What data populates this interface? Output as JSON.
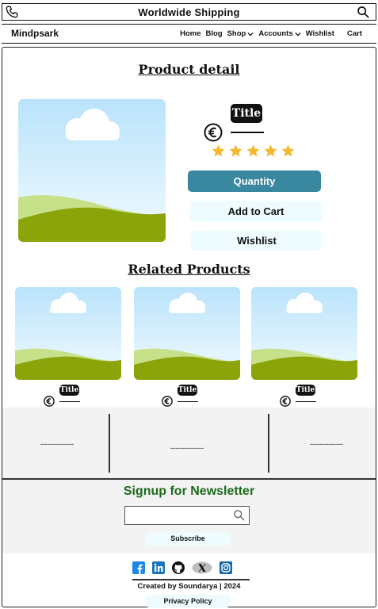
{
  "topbar": {
    "shipping_text": "Worldwide Shipping",
    "phone_icon": "phone-icon",
    "search_icon": "search-icon"
  },
  "nav": {
    "brand": "Mindpsark",
    "items": [
      {
        "label": "Home"
      },
      {
        "label": "Blog"
      },
      {
        "label": "Shop"
      },
      {
        "label": "Accounts"
      },
      {
        "label": "Wishlist"
      },
      {
        "label": "Cart"
      }
    ]
  },
  "product": {
    "heading": "Product detail",
    "title_badge": "Title",
    "currency_icon": "euro-icon",
    "rating": 5,
    "rating_max": 5,
    "quantity_label": "Quantity",
    "add_to_cart_label": "Add to Cart",
    "wishlist_label": "Wishlist"
  },
  "related": {
    "heading": "Related Products",
    "items": [
      {
        "title": "Title"
      },
      {
        "title": "Title"
      },
      {
        "title": "Title"
      }
    ]
  },
  "dashes": [
    "--------------",
    "--------------",
    "--------------"
  ],
  "newsletter": {
    "heading": "Signup for Newsletter",
    "placeholder": "",
    "subscribe_label": "Subscribe"
  },
  "footer": {
    "social_icons": [
      "facebook-icon",
      "linkedin-icon",
      "github-icon",
      "x-icon",
      "instagram-icon"
    ],
    "credit": "Created by Soundarya | 2024",
    "privacy_label": "Privacy Policy"
  },
  "colors": {
    "accent": "#3a87a0",
    "light_button": "#eefcff",
    "newsletter_green": "#1d6a1d",
    "star": "#f5b82e"
  }
}
